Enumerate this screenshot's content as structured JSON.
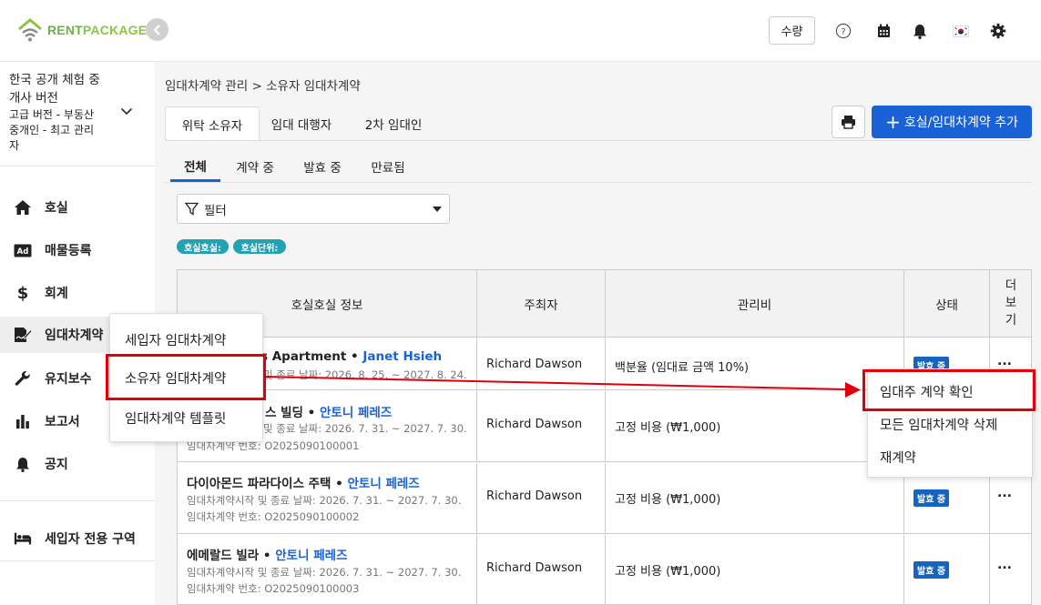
{
  "brand": {
    "part1": "RENT",
    "part2": "PACKAGE",
    "accent": "#6cb33f"
  },
  "header": {
    "qty_label": "수량",
    "icons": [
      "help-icon",
      "calendar-icon",
      "bell-icon",
      "flag-icon",
      "gear-icon"
    ]
  },
  "workspace": {
    "title_line1": "한국 공개 체험 중",
    "title_line2": "개사 버전",
    "sub_line1": "고급 버전 - 부동산",
    "sub_line2": "중개인 - 최고 관리",
    "sub_line3": "자"
  },
  "sidebar": {
    "items": [
      {
        "label": "호실",
        "icon": "home-icon"
      },
      {
        "label": "매물등록",
        "icon": "ad-icon"
      },
      {
        "label": "회계",
        "icon": "dollar-icon"
      },
      {
        "label": "임대차계약",
        "icon": "contract-icon"
      },
      {
        "label": "유지보수",
        "icon": "wrench-icon"
      },
      {
        "label": "보고서",
        "icon": "chart-icon"
      },
      {
        "label": "공지",
        "icon": "bell-icon"
      }
    ],
    "tenant_area": "세입자 전용 구역"
  },
  "flyout": {
    "items": [
      "세입자 임대차계약",
      "소유자 임대차계약",
      "임대차계약 템플릿"
    ]
  },
  "breadcrumb": "임대차계약 관리 > 소유자 임대차계약",
  "tabs_main": [
    "위탁 소유자",
    "임대 대행자",
    "2차 임대인"
  ],
  "print_icon": "printer-icon",
  "add_button": {
    "plus": "+",
    "label": "호실/임대차계약 추가"
  },
  "tabs_status": [
    "전체",
    "계약 중",
    "발효 중",
    "만료됨"
  ],
  "filter": {
    "label": "필터"
  },
  "chips": [
    "호실호실:",
    "호실단위:"
  ],
  "table": {
    "headers": [
      "호실호실 정보",
      "주최자",
      "관리비",
      "상태",
      "더\n보\n기"
    ],
    "header_more": [
      "더",
      "보",
      "기"
    ],
    "rows": [
      {
        "name": "s Apartment",
        "owner": "Janet Hsieh",
        "period": "및 종료 날짜: 2026. 8. 25. ~ 2027. 8. 24.",
        "number": "",
        "host": "Richard Dawson",
        "fee": "백분율 (임대료 금액 10%)",
        "status": "발효 중",
        "more": "..."
      },
      {
        "name": "스 빌딩",
        "owner": "안토니 페레즈",
        "period": "및 종료 날짜: 2026. 7. 31. ~ 2027. 7. 30.",
        "number": "임대차계약 번호: O2025090100001",
        "host": "Richard Dawson",
        "fee": "고정 비용 (₩1,000)",
        "status": "",
        "more": ""
      },
      {
        "name": "다이아몬드 파라다이스 주택",
        "owner": "안토니 페레즈",
        "period": "임대차계약시작 및 종료 날짜: 2026. 7. 31. ~ 2027. 7. 30.",
        "number": "임대차계약 번호: O2025090100002",
        "host": "Richard Dawson",
        "fee": "고정 비용 (₩1,000)",
        "status": "발효 중",
        "more": "..."
      },
      {
        "name": "에메랄드 빌라",
        "owner": "안토니 페레즈",
        "period": "임대차계약시작 및 종료 날짜: 2026. 7. 31. ~ 2027. 7. 30.",
        "number": "임대차계약 번호: O2025090100003",
        "host": "Richard Dawson",
        "fee": "고정 비용 (₩1,000)",
        "status": "발효 중",
        "more": "..."
      }
    ]
  },
  "context_menu": {
    "items": [
      "임대주 계약 확인",
      "모든 임대차계약 삭제",
      "재계약"
    ]
  },
  "colors": {
    "primary": "#1862d6",
    "highlight": "#e0000b",
    "chip": "#26a0b3",
    "badge": "#1565c0"
  }
}
